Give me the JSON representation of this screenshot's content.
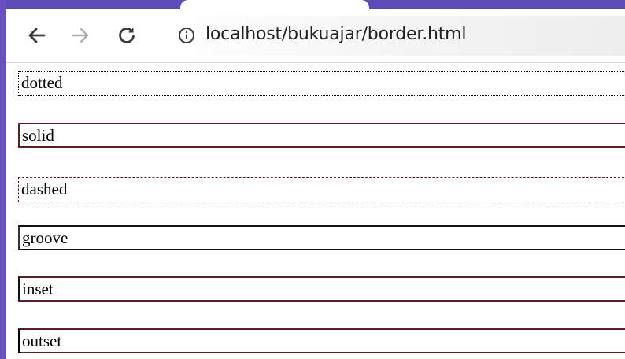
{
  "browser": {
    "address_bar": {
      "url": "localhost/bukuajar/border.html"
    },
    "icons": {
      "back": "back-arrow-icon",
      "forward": "forward-arrow-icon",
      "reload": "reload-icon",
      "site_info": "info-icon"
    }
  },
  "page": {
    "boxes": [
      {
        "label": "dotted"
      },
      {
        "label": "solid"
      },
      {
        "label": "dashed"
      },
      {
        "label": "groove"
      },
      {
        "label": "inset"
      },
      {
        "label": "outset"
      }
    ]
  },
  "colors": {
    "accent_purple": "#6a4fc2",
    "border_maroon": "#5a1e24",
    "border_black": "#000000"
  }
}
